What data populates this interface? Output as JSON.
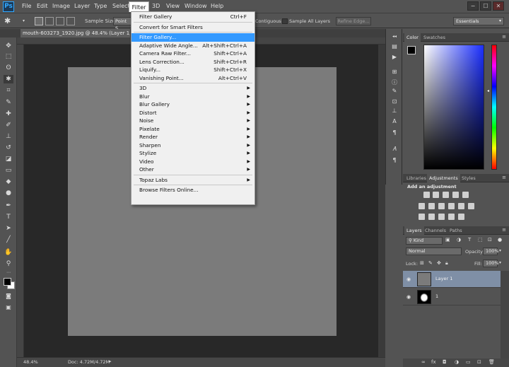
{
  "menubar": {
    "logo": "Ps",
    "items": [
      "File",
      "Edit",
      "Image",
      "Layer",
      "Type",
      "Select",
      "Filter",
      "3D",
      "View",
      "Window",
      "Help"
    ],
    "win_buttons": [
      "−",
      "☐",
      "✕"
    ]
  },
  "options_bar": {
    "sample_size_label": "Sample Size:",
    "sample_size_value": "Point S",
    "contiguous_label": "Contiguous",
    "sample_all_layers_label": "Sample All Layers",
    "refine_edge_label": "Refine Edge...",
    "workspace": "Essentials"
  },
  "document": {
    "tab_title": "mouth-603273_1920.jpg @ 48.4% (Layer 1, RGB/",
    "zoom": "48.4%",
    "doc_size": "Doc: 4.72M/4.72M"
  },
  "filter_menu": {
    "items": [
      {
        "label": "Filter Gallery",
        "shortcut": "Ctrl+F"
      },
      {
        "sep": true
      },
      {
        "label": "Convert for Smart Filters",
        "shortcut": ""
      },
      {
        "sep": true
      },
      {
        "label": "Filter Gallery...",
        "shortcut": "",
        "selected": true
      },
      {
        "label": "Adaptive Wide Angle...",
        "shortcut": "Alt+Shift+Ctrl+A"
      },
      {
        "label": "Camera Raw Filter...",
        "shortcut": "Shift+Ctrl+A"
      },
      {
        "label": "Lens Correction...",
        "shortcut": "Shift+Ctrl+R"
      },
      {
        "label": "Liquify...",
        "shortcut": "Shift+Ctrl+X"
      },
      {
        "label": "Vanishing Point...",
        "shortcut": "Alt+Ctrl+V"
      },
      {
        "sep": true
      },
      {
        "label": "3D",
        "submenu": true
      },
      {
        "label": "Blur",
        "submenu": true
      },
      {
        "label": "Blur Gallery",
        "submenu": true
      },
      {
        "label": "Distort",
        "submenu": true
      },
      {
        "label": "Noise",
        "submenu": true
      },
      {
        "label": "Pixelate",
        "submenu": true
      },
      {
        "label": "Render",
        "submenu": true
      },
      {
        "label": "Sharpen",
        "submenu": true
      },
      {
        "label": "Stylize",
        "submenu": true
      },
      {
        "label": "Video",
        "submenu": true
      },
      {
        "label": "Other",
        "submenu": true
      },
      {
        "sep": true
      },
      {
        "label": "Topaz Labs",
        "submenu": true
      },
      {
        "sep": true
      },
      {
        "label": "Browse Filters Online...",
        "shortcut": ""
      }
    ]
  },
  "color_panel": {
    "tabs": [
      "Color",
      "Swatches"
    ],
    "foreground": "#000000",
    "background": "#ffffff"
  },
  "adjustments_panel": {
    "tabs": [
      "Libraries",
      "Adjustments",
      "Styles"
    ],
    "heading": "Add an adjustment"
  },
  "layers_panel": {
    "tabs": [
      "Layers",
      "Channels",
      "Paths"
    ],
    "kind_label": "Kind",
    "blend_mode": "Normal",
    "opacity_label": "Opacity:",
    "opacity_value": "100%",
    "lock_label": "Lock:",
    "fill_label": "Fill:",
    "fill_value": "100%",
    "layers": [
      {
        "name": "Layer 1",
        "selected": true,
        "thumb": "gray"
      },
      {
        "name": "1",
        "selected": false,
        "thumb": "image"
      }
    ]
  },
  "colors": {
    "ui_bg": "#535353",
    "canvas_bg": "#282828",
    "doc_fill": "#7b7b7b",
    "menu_highlight": "#3399ff",
    "layer_selected": "#7f8fa6"
  }
}
